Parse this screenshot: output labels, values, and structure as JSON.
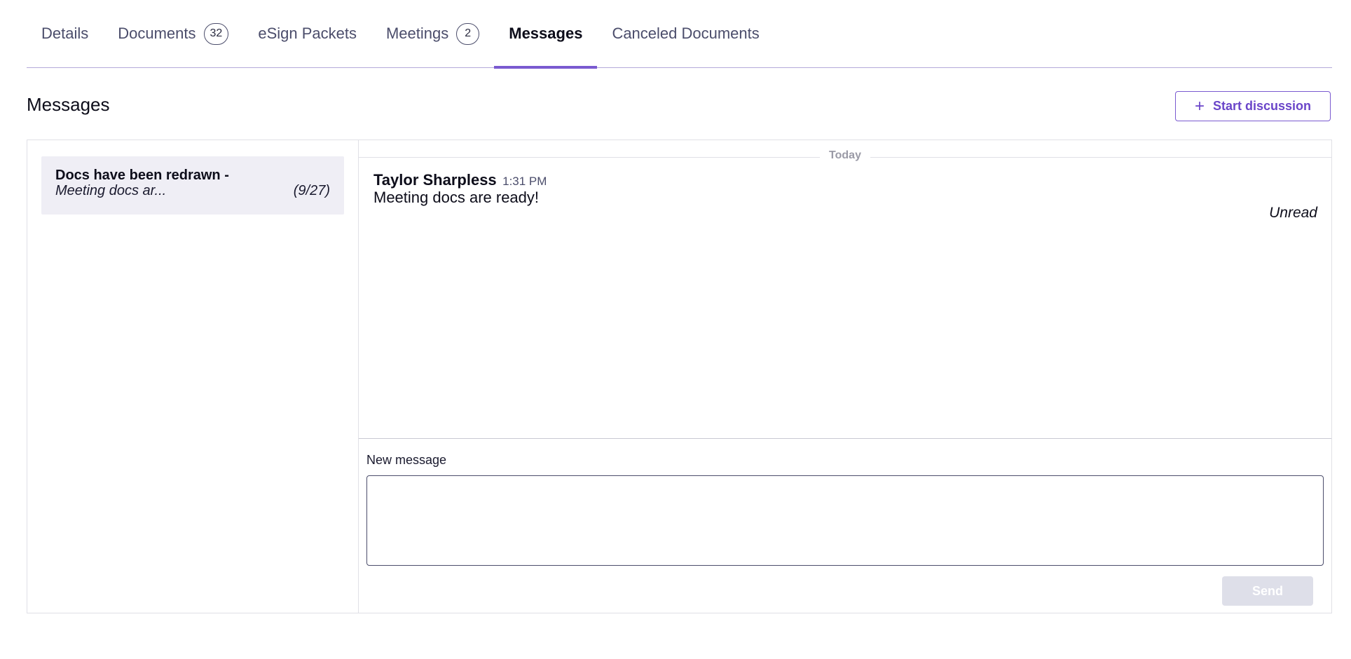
{
  "tabs": [
    {
      "label": "Details",
      "badge": ""
    },
    {
      "label": "Documents",
      "badge": "32"
    },
    {
      "label": "eSign Packets",
      "badge": ""
    },
    {
      "label": "Meetings",
      "badge": "2"
    },
    {
      "label": "Messages",
      "badge": ""
    },
    {
      "label": "Canceled Documents",
      "badge": ""
    }
  ],
  "active_tab": "Messages",
  "section": {
    "title": "Messages",
    "start_button_label": "Start discussion",
    "start_button_icon": "plus-icon"
  },
  "threads": [
    {
      "title": "Docs have been redrawn -",
      "preview": "Meeting docs ar...",
      "date": "(9/27)"
    }
  ],
  "conversation": {
    "day_divider": "Today",
    "messages": [
      {
        "author": "Taylor Sharpless",
        "time": "1:31 PM",
        "body": "Meeting docs are ready!",
        "status": "Unread"
      }
    ]
  },
  "compose": {
    "label": "New message",
    "value": "",
    "send_label": "Send"
  },
  "colors": {
    "accent": "#7a5ad0",
    "send_disabled": "#dedfe9"
  }
}
